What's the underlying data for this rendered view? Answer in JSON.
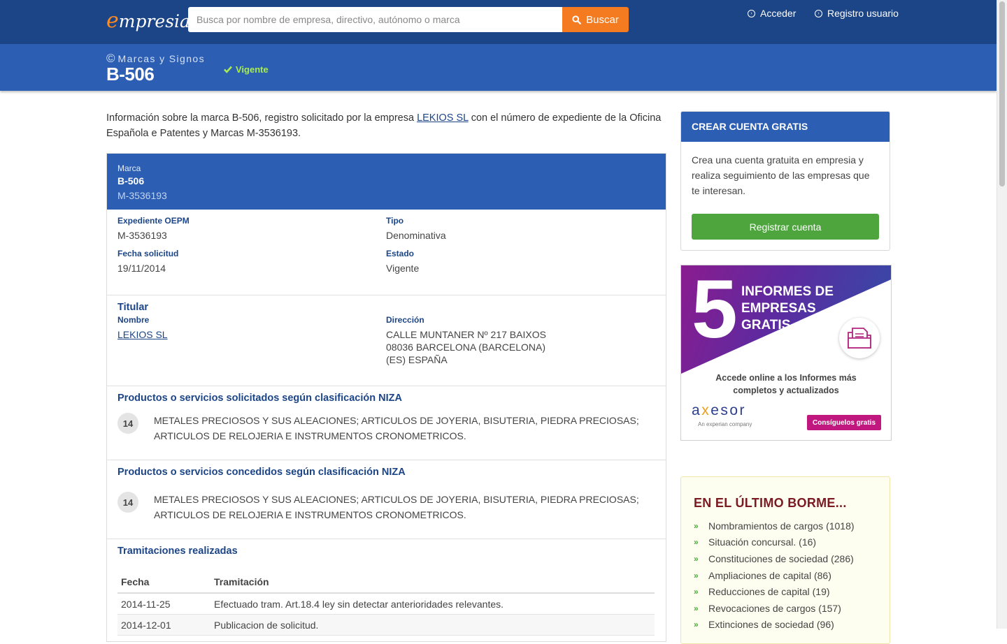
{
  "header": {
    "logo_e": "e",
    "logo_rest": "mpresia",
    "search_placeholder": "Busca por nombre de empresa, directivo, autónomo o marca",
    "search_button": "Buscar",
    "login": "Acceder",
    "register": "Registro usuario"
  },
  "subheader": {
    "section": "Marcas y Signos",
    "title": "B-506",
    "status": "Vigente"
  },
  "intro": {
    "before": "Información sobre la marca B-506, registro solicitado por la empresa ",
    "company_link": "LEKIOS SL",
    "after": " con el número de expediente de la Oficina Española e Patentes y Marcas M-3536193."
  },
  "card": {
    "head_label": "Marca",
    "head_name": "B-506",
    "head_number": "M-3536193",
    "fields": {
      "expediente_label": "Expediente OEPM",
      "expediente_value": "M-3536193",
      "tipo_label": "Tipo",
      "tipo_value": "Denominativa",
      "fecha_label": "Fecha solicitud",
      "fecha_value": "19/11/2014",
      "estado_label": "Estado",
      "estado_value": "Vigente"
    },
    "titular": {
      "title": "Titular",
      "nombre_label": "Nombre",
      "nombre_value": "LEKIOS SL",
      "direccion_label": "Dirección",
      "direccion_lines": [
        "CALLE MUNTANER Nº 217 BAIXOS",
        "08036 BARCELONA (BARCELONA)",
        "(ES) ESPAÑA"
      ]
    },
    "solicitados": {
      "title": "Productos o servicios solicitados según clasificación NIZA",
      "class": "14",
      "text": "METALES PRECIOSOS Y SUS ALEACIONES; ARTICULOS DE JOYERIA, BISUTERIA, PIEDRA PRECIOSAS; ARTICULOS DE RELOJERIA E INSTRUMENTOS CRONOMETRICOS."
    },
    "concedidos": {
      "title": "Productos o servicios concedidos según clasificación NIZA",
      "class": "14",
      "text": "METALES PRECIOSOS Y SUS ALEACIONES; ARTICULOS DE JOYERIA, BISUTERIA, PIEDRA PRECIOSAS; ARTICULOS DE RELOJERIA E INSTRUMENTOS CRONOMETRICOS."
    },
    "tramitaciones": {
      "title": "Tramitaciones realizadas",
      "headers": [
        "Fecha",
        "Tramitación"
      ],
      "rows": [
        [
          "2014-11-25",
          "Efectuado tram. Art.18.4 ley sin detectar anterioridades relevantes."
        ],
        [
          "2014-12-01",
          "Publicacion de solicitud."
        ]
      ]
    }
  },
  "sidebar": {
    "account": {
      "title": "CREAR CUENTA GRATIS",
      "text": "Crea una cuenta gratuita en empresia y realiza seguimiento de las empresas que te interesan.",
      "button": "Registrar cuenta"
    },
    "ad": {
      "number": "5",
      "heading_lines": [
        "INFORMES DE",
        "EMPRESAS",
        "GRATIS"
      ],
      "subtitle_lines": [
        "Accede online a los Informes más",
        "completos y actualizados"
      ],
      "brand_a": "a",
      "brand_x": "x",
      "brand_rest": "esor",
      "brand_sub": "An experian company",
      "button": "Consíguelos gratis",
      "colors": {
        "magenta": "#c0187e",
        "purple": "#5c2ba0"
      }
    },
    "borme": {
      "title": "EN EL ÚLTIMO BORME...",
      "items": [
        "Nombramientos de cargos (1018)",
        "Situación concursal. (16)",
        "Constituciones de sociedad (286)",
        "Ampliaciones de capital (86)",
        "Reducciones de capital (19)",
        "Revocaciones de cargos (157)",
        "Extinciones de sociedad (96)"
      ]
    }
  },
  "colors": {
    "navy": "#1c4587",
    "blue": "#2c5fb4",
    "orange": "#f47b20",
    "green": "#4ea53d",
    "status_green": "#a8ec50"
  }
}
